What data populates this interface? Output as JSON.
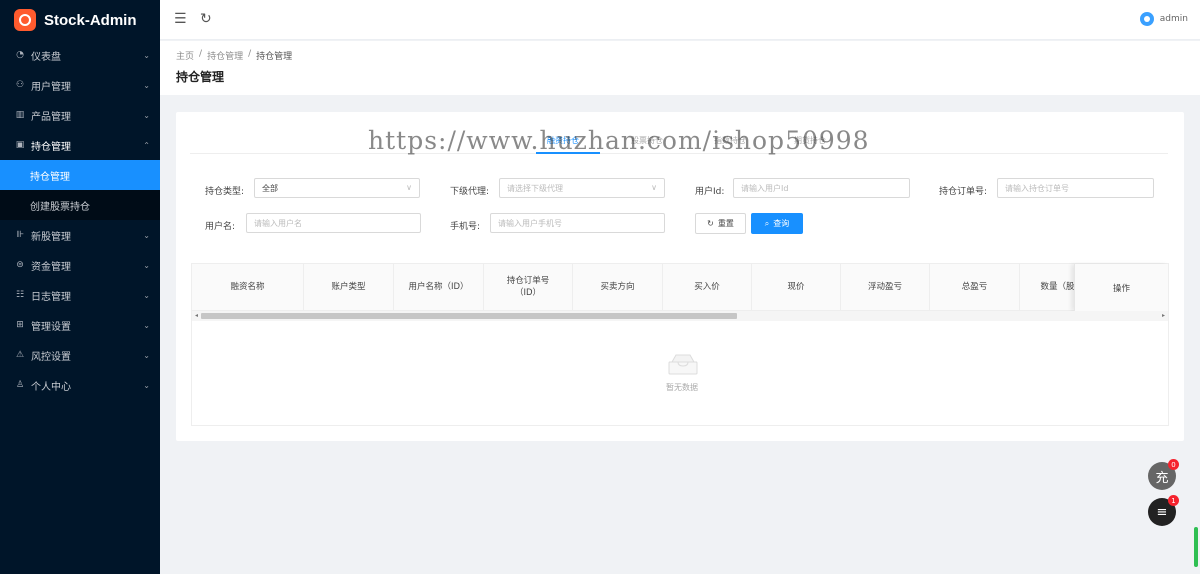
{
  "app": {
    "name": "Stock-Admin"
  },
  "sidebar": {
    "items": [
      {
        "icon": "dashboard-icon",
        "glyph": "◔",
        "label": "仪表盘",
        "expanded": false
      },
      {
        "icon": "users-icon",
        "glyph": "⚇",
        "label": "用户管理",
        "expanded": false
      },
      {
        "icon": "chart-icon",
        "glyph": "▥",
        "label": "产品管理",
        "expanded": false
      },
      {
        "icon": "position-icon",
        "glyph": "▣",
        "label": "持仓管理",
        "expanded": true,
        "children": [
          {
            "label": "持仓管理",
            "active": true
          },
          {
            "label": "创建股票持仓",
            "active": false
          }
        ]
      },
      {
        "icon": "newstock-icon",
        "glyph": "⊪",
        "label": "新股管理",
        "expanded": false
      },
      {
        "icon": "funds-icon",
        "glyph": "⊜",
        "label": "资金管理",
        "expanded": false
      },
      {
        "icon": "log-icon",
        "glyph": "☷",
        "label": "日志管理",
        "expanded": false
      },
      {
        "icon": "settings-icon",
        "glyph": "⊞",
        "label": "管理设置",
        "expanded": false
      },
      {
        "icon": "risk-icon",
        "glyph": "⚠",
        "label": "风控设置",
        "expanded": false
      },
      {
        "icon": "user-icon",
        "glyph": "♙",
        "label": "个人中心",
        "expanded": false
      }
    ]
  },
  "header": {
    "user_name": "admin"
  },
  "breadcrumb": {
    "home": "主页",
    "parent": "持仓管理",
    "current": "持仓管理"
  },
  "page": {
    "title": "持仓管理"
  },
  "tabs": [
    {
      "label": "融资持仓",
      "active": true
    },
    {
      "label": "股票持仓",
      "active": false
    },
    {
      "label": "指数持仓",
      "active": false
    },
    {
      "label": "期货持仓",
      "active": false
    }
  ],
  "watermark": "https://www.huzhan.com/ishop50998",
  "filters": {
    "position_type": {
      "label": "持仓类型:",
      "value": "全部"
    },
    "agent": {
      "label": "下级代理:",
      "placeholder": "请选择下级代理"
    },
    "user_id": {
      "label": "用户Id:",
      "placeholder": "请输入用户Id"
    },
    "order_no": {
      "label": "持仓订单号:",
      "placeholder": "请输入持仓订单号"
    },
    "username": {
      "label": "用户名:",
      "placeholder": "请输入用户名"
    },
    "phone": {
      "label": "手机号:",
      "placeholder": "请输入用户手机号"
    }
  },
  "buttons": {
    "reset": "重置",
    "query": "查询"
  },
  "table": {
    "columns": [
      "融资名称",
      "账户类型",
      "用户名称（ID）",
      "持仓订单号\n（ID）",
      "买卖方向",
      "买入价",
      "现价",
      "浮动盈亏",
      "总盈亏",
      "数量（股"
    ],
    "action_column": "操作",
    "rows": [],
    "empty_text": "暂无数据"
  },
  "floating": {
    "charge": {
      "label": "充",
      "badge": "0"
    },
    "service": {
      "icon": "chat-list-icon",
      "badge": "1"
    }
  }
}
